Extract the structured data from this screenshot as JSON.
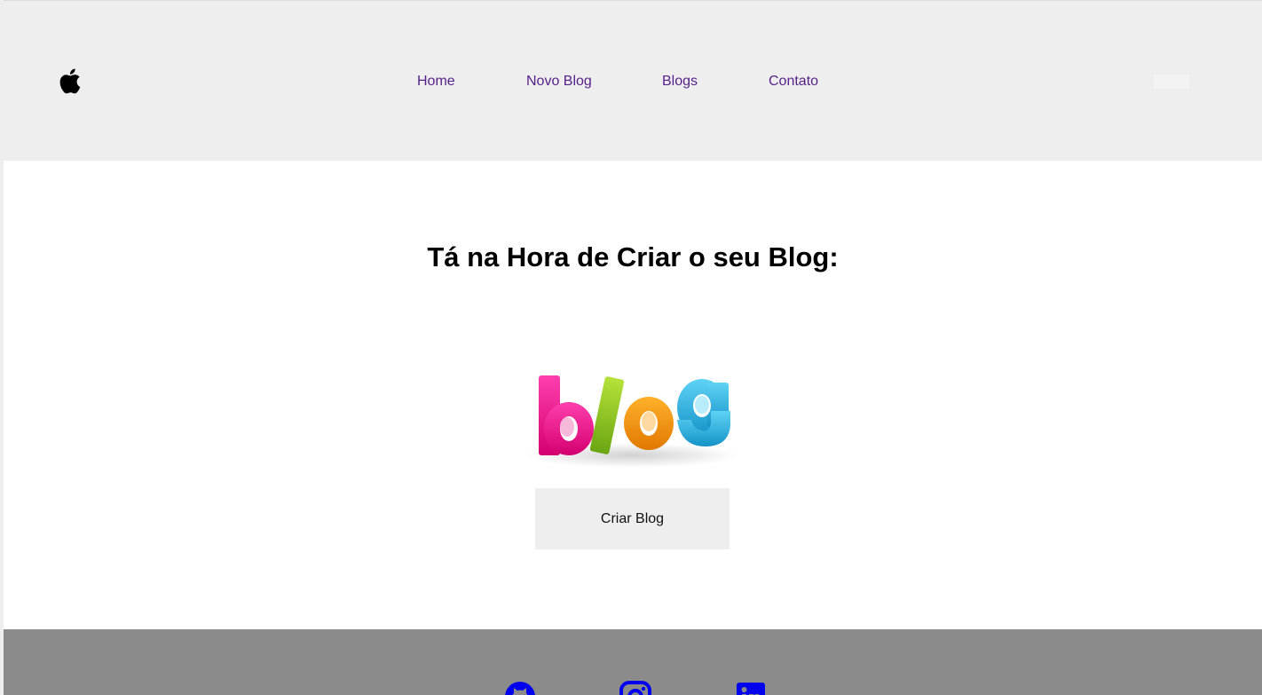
{
  "header": {
    "logo_icon": "apple-icon",
    "nav": [
      {
        "label": "Home"
      },
      {
        "label": "Novo Blog"
      },
      {
        "label": "Blogs"
      },
      {
        "label": "Contato"
      }
    ]
  },
  "main": {
    "title": "Tá na Hora de Criar o seu Blog:",
    "image_text": "blog",
    "button_label": "Criar Blog"
  },
  "footer": {
    "icons": [
      "github-icon",
      "instagram-icon",
      "linkedin-icon"
    ]
  },
  "colors": {
    "header_bg": "#eeeeee",
    "nav_link": "#56228a",
    "footer_bg": "#8b8b8b",
    "footer_icon": "#0000ee",
    "button_bg": "#eeeeee"
  }
}
